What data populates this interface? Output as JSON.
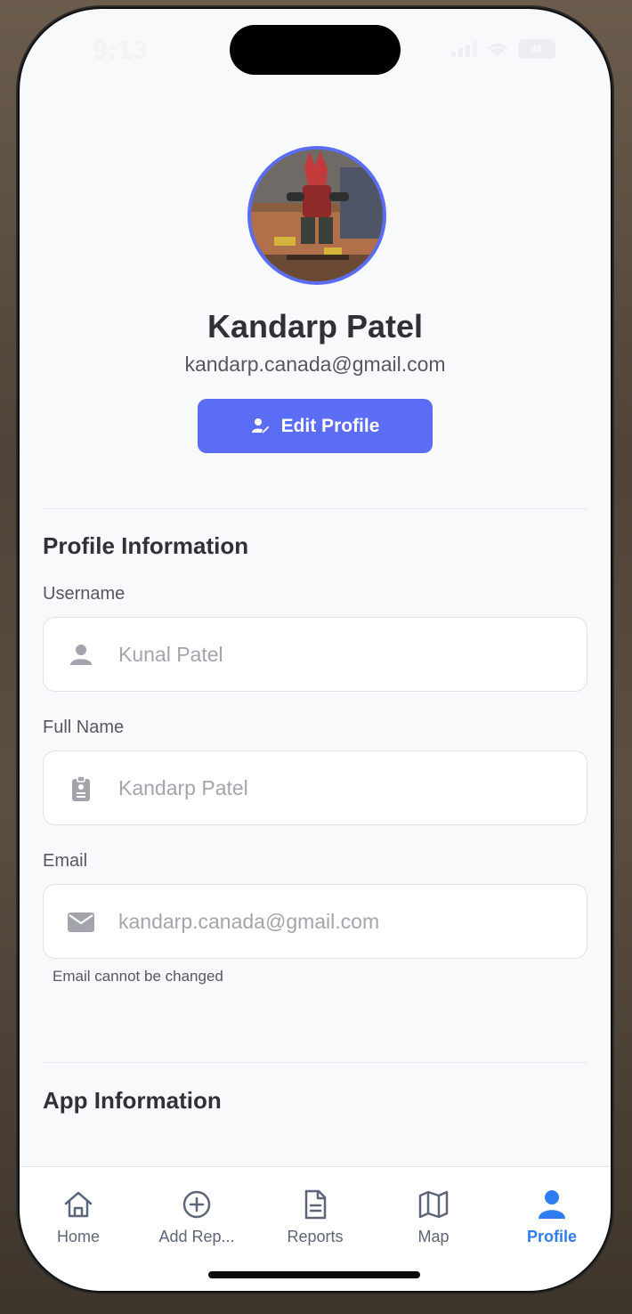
{
  "status_bar": {
    "time": "9:13",
    "battery": "46"
  },
  "profile": {
    "name": "Kandarp Patel",
    "email": "kandarp.canada@gmail.com",
    "edit_button_label": "Edit Profile"
  },
  "profile_information": {
    "title": "Profile Information",
    "fields": [
      {
        "label": "Username",
        "value": "Kunal Patel",
        "icon": "person-icon"
      },
      {
        "label": "Full Name",
        "value": "Kandarp Patel",
        "icon": "id-badge-icon"
      },
      {
        "label": "Email",
        "value": "kandarp.canada@gmail.com",
        "icon": "envelope-icon"
      }
    ],
    "email_hint": "Email cannot be changed"
  },
  "app_information": {
    "title": "App Information"
  },
  "colors": {
    "accent": "#5b6cf5",
    "active_tab": "#2e7cf0",
    "inactive_tab": "#5d6677"
  },
  "tabs": [
    {
      "label": "Home",
      "icon": "home-icon",
      "active": false
    },
    {
      "label": "Add Rep...",
      "icon": "plus-circle-icon",
      "active": false
    },
    {
      "label": "Reports",
      "icon": "document-icon",
      "active": false
    },
    {
      "label": "Map",
      "icon": "map-icon",
      "active": false
    },
    {
      "label": "Profile",
      "icon": "person-icon",
      "active": true
    }
  ]
}
